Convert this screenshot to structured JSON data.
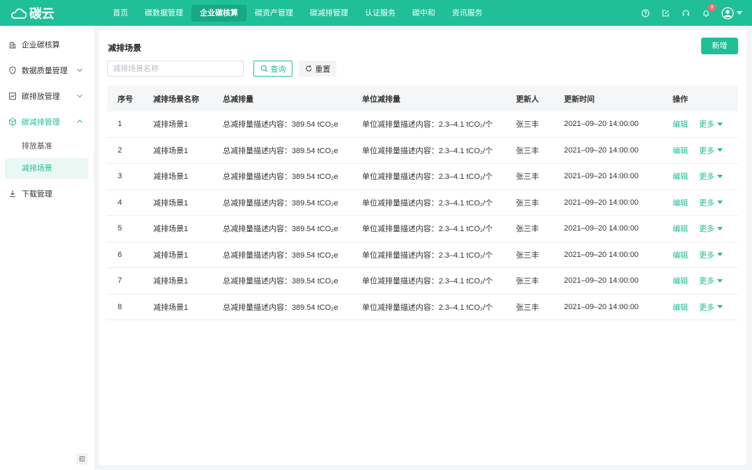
{
  "app": {
    "logo_text": "碳云"
  },
  "nav": [
    {
      "label": "首页",
      "active": false
    },
    {
      "label": "碳数据管理",
      "active": false
    },
    {
      "label": "企业碳核算",
      "active": true
    },
    {
      "label": "碳资产管理",
      "active": false
    },
    {
      "label": "碳减排管理",
      "active": false
    },
    {
      "label": "认证服务",
      "active": false
    },
    {
      "label": "碳中和",
      "active": false
    },
    {
      "label": "资讯服务",
      "active": false
    }
  ],
  "header_icons": {
    "notifications_count": "9"
  },
  "sidebar": {
    "items": [
      {
        "label": "企业碳核算",
        "icon": "building-icon"
      },
      {
        "label": "数据质量管理",
        "icon": "shield-icon"
      },
      {
        "label": "碳排放管理",
        "icon": "chart-icon"
      },
      {
        "label": "碳减排管理",
        "icon": "cube-icon",
        "open": true,
        "children": [
          {
            "label": "排放基准"
          },
          {
            "label": "减排场景",
            "active": true
          }
        ]
      },
      {
        "label": "下载管理",
        "icon": "download-icon"
      }
    ]
  },
  "main": {
    "title": "减排场景",
    "add_label": "新增",
    "search_placeholder": "减排场景名称",
    "query_label": "查询",
    "reset_label": "重置",
    "columns": [
      "序号",
      "减排场景名称",
      "总减排量",
      "单位减排量",
      "更新人",
      "更新时间",
      "操作"
    ],
    "edit_label": "编辑",
    "more_label": "更多",
    "rows": [
      {
        "no": "1",
        "name": "减排场景1",
        "total": "总减排量描述内容：389.54 tCO₂e",
        "unit": "单位减排量描述内容：2.3–4.1 tCO₂/个",
        "updater": "张三丰",
        "time": "2021–09–20 14:00:00"
      },
      {
        "no": "2",
        "name": "减排场景1",
        "total": "总减排量描述内容：389.54 tCO₂e",
        "unit": "单位减排量描述内容：2.3–4.1 tCO₂/个",
        "updater": "张三丰",
        "time": "2021–09–20 14:00:00"
      },
      {
        "no": "3",
        "name": "减排场景1",
        "total": "总减排量描述内容：389.54 tCO₂e",
        "unit": "单位减排量描述内容：2.3–4.1 tCO₂/个",
        "updater": "张三丰",
        "time": "2021–09–20 14:00:00"
      },
      {
        "no": "4",
        "name": "减排场景1",
        "total": "总减排量描述内容：389.54 tCO₂e",
        "unit": "单位减排量描述内容：2.3–4.1 tCO₂/个",
        "updater": "张三丰",
        "time": "2021–09–20 14:00:00"
      },
      {
        "no": "5",
        "name": "减排场景1",
        "total": "总减排量描述内容：389.54 tCO₂e",
        "unit": "单位减排量描述内容：2.3–4.1 tCO₂/个",
        "updater": "张三丰",
        "time": "2021–09–20 14:00:00"
      },
      {
        "no": "6",
        "name": "减排场景1",
        "total": "总减排量描述内容：389.54 tCO₂e",
        "unit": "单位减排量描述内容：2.3–4.1 tCO₂/个",
        "updater": "张三丰",
        "time": "2021–09–20 14:00:00"
      },
      {
        "no": "7",
        "name": "减排场景1",
        "total": "总减排量描述内容：389.54 tCO₂e",
        "unit": "单位减排量描述内容：2.3–4.1 tCO₂/个",
        "updater": "张三丰",
        "time": "2021–09–20 14:00:00"
      },
      {
        "no": "8",
        "name": "减排场景1",
        "total": "总减排量描述内容：389.54 tCO₂e",
        "unit": "单位减排量描述内容：2.3–4.1 tCO₂/个",
        "updater": "张三丰",
        "time": "2021–09–20 14:00:00"
      }
    ]
  },
  "colors": {
    "brand": "#1fbf97",
    "brand_dark": "#17a884",
    "badge": "#f56c6c"
  }
}
